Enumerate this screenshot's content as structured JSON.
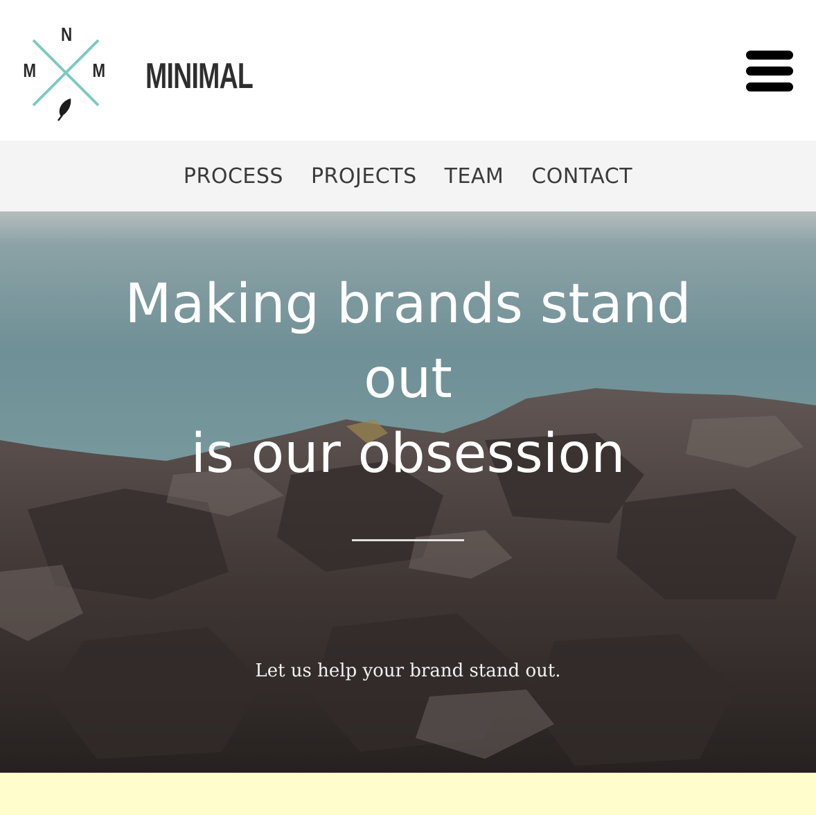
{
  "brand": {
    "logo_letters": {
      "top": "N",
      "left": "M",
      "right": "M"
    },
    "name": "MINIMAL",
    "accent_color": "#7cc9c3"
  },
  "menu": {
    "icon": "hamburger-menu-icon"
  },
  "nav": {
    "items": [
      {
        "label": "PROCESS"
      },
      {
        "label": "PROJECTS"
      },
      {
        "label": "TEAM"
      },
      {
        "label": "CONTACT"
      }
    ]
  },
  "hero": {
    "title_line1": "Making brands stand",
    "title_line2": "out",
    "title_line3": "is our obsession",
    "subtitle": "Let us help your brand stand out."
  },
  "colors": {
    "nav_bg": "#f4f4f4",
    "next_section_bg": "#fffdcb"
  }
}
